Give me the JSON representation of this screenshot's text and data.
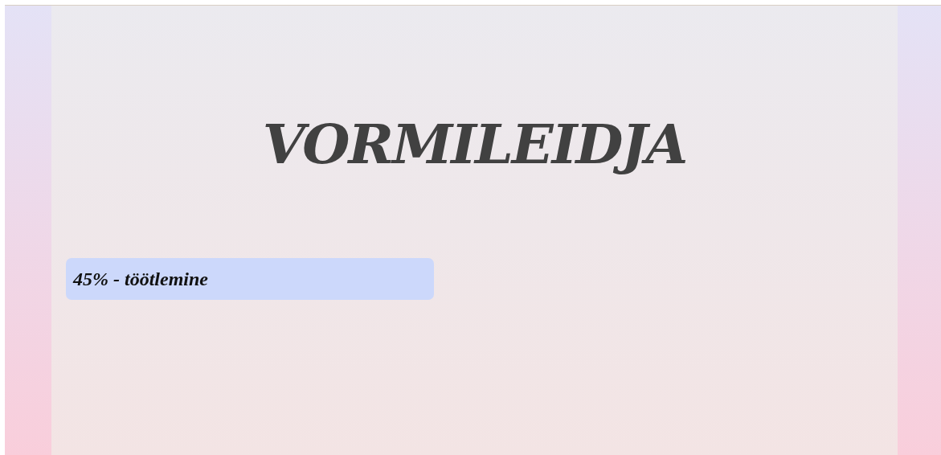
{
  "title": "VORMILEIDJA",
  "progress": {
    "label": "45% - töötlemine"
  }
}
